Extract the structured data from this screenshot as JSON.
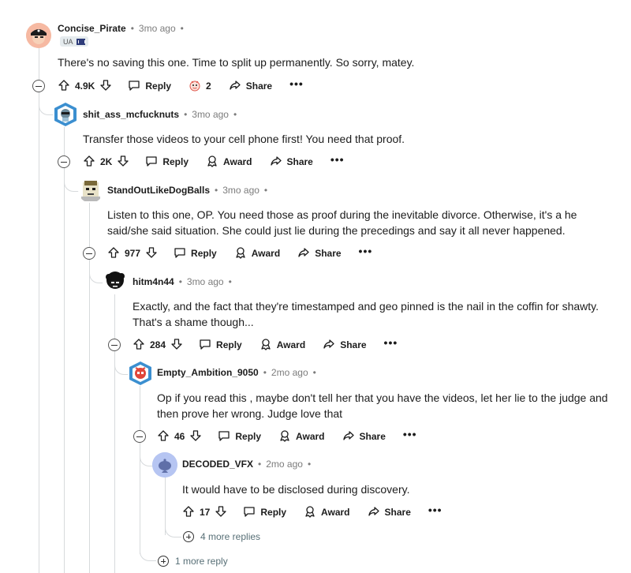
{
  "comments": [
    {
      "author": "Concise_Pirate",
      "time": "3mo ago",
      "flair": "UA",
      "text": "There's no saving this one. Time to split up permanently. So sorry, matey.",
      "votes": "4.9K",
      "award_count": "2",
      "actions": {
        "reply": "Reply",
        "share": "Share",
        "more": "•••"
      }
    },
    {
      "author": "shit_ass_mcfucknuts",
      "time": "3mo ago",
      "text": "Transfer those videos to your cell phone first! You need that proof.",
      "votes": "2K",
      "actions": {
        "reply": "Reply",
        "award": "Award",
        "share": "Share",
        "more": "•••"
      }
    },
    {
      "author": "StandOutLikeDogBalls",
      "time": "3mo ago",
      "text_line1": "Listen to this one, OP. You need those as proof during the inevitable divorce. Otherwise, it's a he",
      "text_line2": "said/she said situation. She could just lie during the precedings and say it all never happened.",
      "votes": "977",
      "actions": {
        "reply": "Reply",
        "award": "Award",
        "share": "Share",
        "more": "•••"
      }
    },
    {
      "author": "hitm4n44",
      "time": "3mo ago",
      "text_line1": "Exactly, and the fact that they're timestamped and geo pinned is the nail in the coffin for shawty.",
      "text_line2": "That's a shame though...",
      "votes": "284",
      "actions": {
        "reply": "Reply",
        "award": "Award",
        "share": "Share",
        "more": "•••"
      }
    },
    {
      "author": "Empty_Ambition_9050",
      "time": "2mo ago",
      "text_line1": "Op if you read this , maybe don't tell her that you have the videos, let her lie to the judge and",
      "text_line2": "then prove her wrong. Judge love that",
      "votes": "46",
      "actions": {
        "reply": "Reply",
        "award": "Award",
        "share": "Share",
        "more": "•••"
      }
    },
    {
      "author": "DECODED_VFX",
      "time": "2mo ago",
      "text": "It would have to be disclosed during discovery.",
      "votes": "17",
      "actions": {
        "reply": "Reply",
        "award": "Award",
        "share": "Share",
        "more": "•••"
      }
    }
  ],
  "more_replies": {
    "four": "4 more replies",
    "one": "1 more reply"
  }
}
